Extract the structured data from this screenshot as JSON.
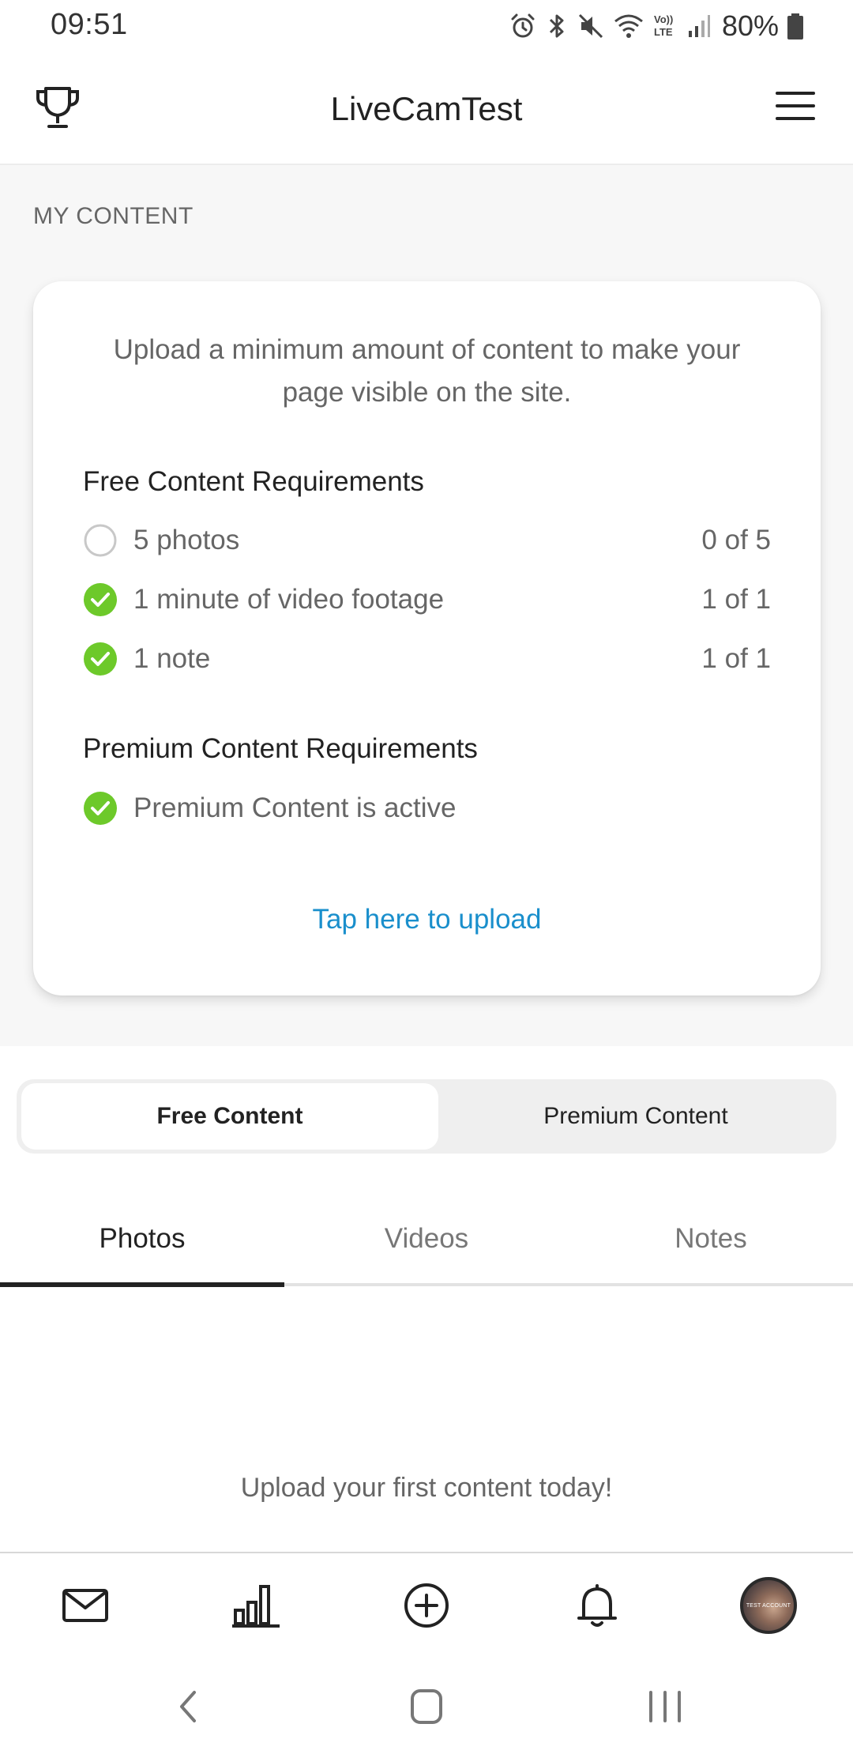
{
  "status_bar": {
    "time": "09:51",
    "battery": "80%",
    "icons": [
      "alarm-icon",
      "bluetooth-icon",
      "mute-icon",
      "wifi-icon",
      "volte-icon",
      "signal-icon",
      "battery-icon"
    ],
    "volte_label": [
      "Vo))",
      "LTE"
    ]
  },
  "header": {
    "title": "LiveCamTest",
    "left_icon": "trophy-icon",
    "right_icon": "menu-icon"
  },
  "my_content": {
    "section_label": "MY CONTENT",
    "card": {
      "intro": "Upload a minimum amount of content to make your page visible on the site.",
      "free_heading": "Free Content Requirements",
      "free_items": [
        {
          "label": "5 photos",
          "count": "0 of 5",
          "done": false
        },
        {
          "label": "1 minute of video footage",
          "count": "1 of 1",
          "done": true
        },
        {
          "label": "1 note",
          "count": "1 of 1",
          "done": true
        }
      ],
      "premium_heading": "Premium Content Requirements",
      "premium_items": [
        {
          "label": "Premium Content is active",
          "done": true
        }
      ],
      "upload_link": "Tap here to upload"
    }
  },
  "segmented": {
    "options": [
      "Free Content",
      "Premium Content"
    ],
    "selected": "Free Content"
  },
  "tabs": {
    "items": [
      "Photos",
      "Videos",
      "Notes"
    ],
    "selected": "Photos"
  },
  "empty_state": "Upload your first content today!",
  "bottom_nav": {
    "items": [
      "mail-icon",
      "stats-icon",
      "add-icon",
      "bell-icon",
      "profile-avatar"
    ],
    "avatar_text": "TEST ACCOUNT"
  },
  "system_nav": [
    "back-icon",
    "home-icon",
    "recents-icon"
  ],
  "colors": {
    "accent_link": "#1a8fcc",
    "check_green": "#6dc92a",
    "background_gray": "#f7f7f7"
  }
}
